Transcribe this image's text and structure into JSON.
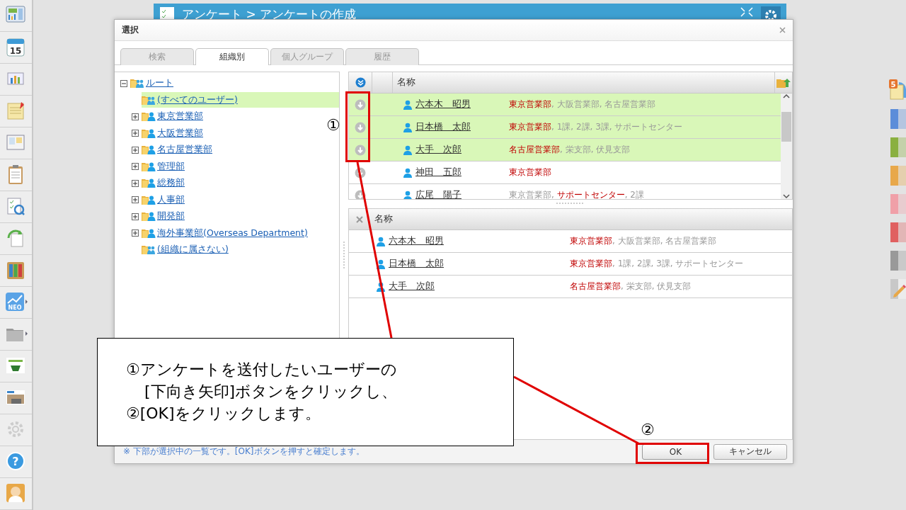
{
  "sidebar": {
    "calendar_day": "15",
    "neo_label": "NEO",
    "help_mark": "?"
  },
  "dock": {
    "badge": "5",
    "tabs": [
      {
        "color": "#5b8dd9"
      },
      {
        "color": "#8ab040"
      },
      {
        "color": "#e8a84a"
      },
      {
        "color": "#f0a0a8"
      },
      {
        "color": "#e06060"
      },
      {
        "color": "#999999"
      }
    ]
  },
  "background_window": {
    "title": "アンケート > アンケートの作成"
  },
  "dialog": {
    "title": "選択",
    "tabs": [
      {
        "label": "検索",
        "selected": false
      },
      {
        "label": "組織別",
        "selected": true
      },
      {
        "label": "個人グループ",
        "selected": false
      },
      {
        "label": "履歴",
        "selected": false
      }
    ],
    "tree": {
      "label": "ルート",
      "kind": "group",
      "expanded": true,
      "selected": false,
      "children": [
        {
          "label": "(すべてのユーザー)",
          "kind": "group",
          "selected": true
        },
        {
          "label": "東京営業部",
          "kind": "dept",
          "expanded": false,
          "selected": false
        },
        {
          "label": "大阪営業部",
          "kind": "dept",
          "expanded": false,
          "selected": false
        },
        {
          "label": "名古屋営業部",
          "kind": "dept",
          "expanded": false,
          "selected": false
        },
        {
          "label": "管理部",
          "kind": "dept",
          "expanded": false,
          "selected": false
        },
        {
          "label": "総務部",
          "kind": "dept",
          "expanded": false,
          "selected": false
        },
        {
          "label": "人事部",
          "kind": "dept",
          "expanded": false,
          "selected": false
        },
        {
          "label": "開発部",
          "kind": "dept",
          "expanded": false,
          "selected": false
        },
        {
          "label": "海外事業部(Overseas Department)",
          "kind": "dept",
          "expanded": false,
          "selected": false
        },
        {
          "label": "(組織に属さない)",
          "kind": "group",
          "selected": false
        }
      ]
    },
    "candidates": {
      "header": "名称",
      "rows": [
        {
          "name": "六本木　昭男",
          "selected": true,
          "parts": [
            {
              "text": "東京営業部",
              "main": true
            },
            {
              "text": ", 大阪営業部, 名古屋営業部",
              "main": false
            }
          ]
        },
        {
          "name": "日本橋　太郎",
          "selected": true,
          "parts": [
            {
              "text": "東京営業部",
              "main": true
            },
            {
              "text": ", 1課, 2課, 3課, サポートセンター",
              "main": false
            }
          ]
        },
        {
          "name": "大手　次郎",
          "selected": true,
          "parts": [
            {
              "text": "名古屋営業部",
              "main": true
            },
            {
              "text": ", 栄支部, 伏見支部",
              "main": false
            }
          ]
        },
        {
          "name": "神田　五郎",
          "selected": false,
          "parts": [
            {
              "text": "東京営業部",
              "main": true
            }
          ]
        },
        {
          "name": "広尾　陽子",
          "selected": false,
          "parts": [
            {
              "text": "東京営業部, ",
              "main": false
            },
            {
              "text": "サポートセンター",
              "main": true
            },
            {
              "text": ", 2課",
              "main": false
            }
          ]
        }
      ]
    },
    "chosen": {
      "header": "名称",
      "rows": [
        {
          "name": "六本木　昭男",
          "parts": [
            {
              "text": "東京営業部",
              "main": true
            },
            {
              "text": ", 大阪営業部, 名古屋営業部",
              "main": false
            }
          ]
        },
        {
          "name": "日本橋　太郎",
          "parts": [
            {
              "text": "東京営業部",
              "main": true
            },
            {
              "text": ", 1課, 2課, 3課, サポートセンター",
              "main": false
            }
          ]
        },
        {
          "name": "大手　次郎",
          "parts": [
            {
              "text": "名古屋営業部",
              "main": true
            },
            {
              "text": ", 栄支部, 伏見支部",
              "main": false
            }
          ]
        }
      ]
    },
    "note": "※ 下部が選択中の一覧です。[OK]ボタンを押すと確定します。",
    "buttons": [
      {
        "label": "OK",
        "kind": "primary"
      },
      {
        "label": "キャンセル",
        "kind": "secondary"
      }
    ]
  },
  "annotation": {
    "marker_1": "①",
    "marker_2": "②",
    "callout": [
      {
        "text": "①アンケートを送付したいユーザーの",
        "indent": false
      },
      {
        "text": "[下向き矢印]ボタンをクリックし、",
        "indent": true
      },
      {
        "text": "②[OK]をクリックします。",
        "indent": false
      }
    ]
  }
}
